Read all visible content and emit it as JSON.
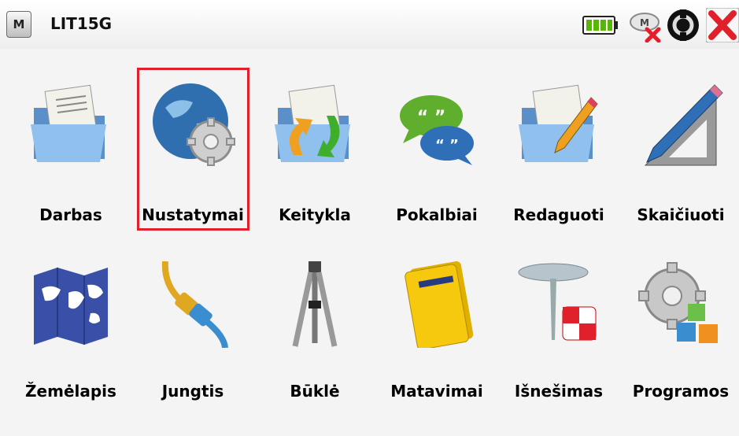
{
  "titlebar": {
    "menu_button": "M",
    "title": "LIT15G",
    "status_icons": [
      "battery-icon",
      "cloud-disconnected-icon",
      "sync-icon",
      "close-icon"
    ]
  },
  "tiles": [
    {
      "label": "Darbas",
      "icon": "folder-document-icon"
    },
    {
      "label": "Nustatymai",
      "icon": "globe-gear-icon",
      "selected": true
    },
    {
      "label": "Keitykla",
      "icon": "folder-exchange-icon"
    },
    {
      "label": "Pokalbiai",
      "icon": "chat-bubbles-icon"
    },
    {
      "label": "Redaguoti",
      "icon": "folder-pencil-icon"
    },
    {
      "label": "Skaičiuoti",
      "icon": "pencil-ruler-icon"
    },
    {
      "label": "Žemėlapis",
      "icon": "world-map-icon"
    },
    {
      "label": "Jungtis",
      "icon": "cable-icon"
    },
    {
      "label": "Būklė",
      "icon": "tripod-icon"
    },
    {
      "label": "Matavimai",
      "icon": "notebook-icon"
    },
    {
      "label": "Išnešimas",
      "icon": "stakeout-nail-icon"
    },
    {
      "label": "Programos",
      "icon": "gear-blocks-icon"
    }
  ],
  "colors": {
    "highlight": "#e0202a",
    "background": "#f4f4f4"
  }
}
